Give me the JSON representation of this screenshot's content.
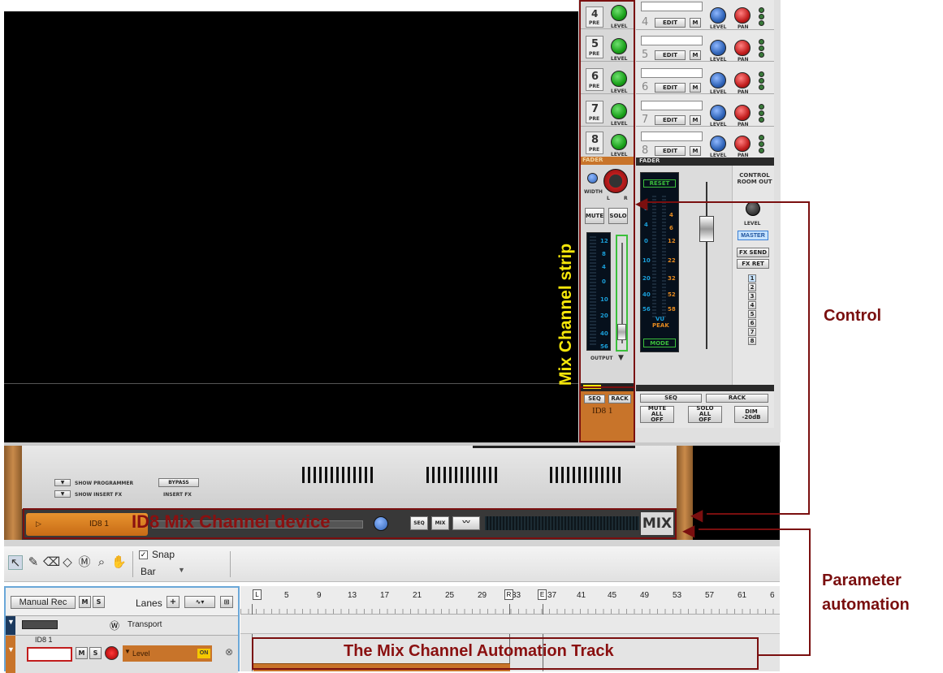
{
  "mixer": {
    "rows": [
      {
        "num": "4",
        "pre": "PRE",
        "level": "LEVEL"
      },
      {
        "num": "5",
        "pre": "PRE",
        "level": "LEVEL"
      },
      {
        "num": "6",
        "pre": "PRE",
        "level": "LEVEL"
      },
      {
        "num": "7",
        "pre": "PRE",
        "level": "LEVEL"
      },
      {
        "num": "8",
        "pre": "PRE",
        "level": "LEVEL"
      }
    ],
    "master_rows": [
      {
        "num": "4",
        "edit": "EDIT",
        "m": "M",
        "level": "LEVEL",
        "pan": "PAN"
      },
      {
        "num": "5",
        "edit": "EDIT",
        "m": "M",
        "level": "LEVEL",
        "pan": "PAN"
      },
      {
        "num": "6",
        "edit": "EDIT",
        "m": "M",
        "level": "LEVEL",
        "pan": "PAN"
      },
      {
        "num": "7",
        "edit": "EDIT",
        "m": "M",
        "level": "LEVEL",
        "pan": "PAN"
      },
      {
        "num": "8",
        "edit": "EDIT",
        "m": "M",
        "level": "LEVEL",
        "pan": "PAN"
      }
    ],
    "fader_label": "FADER",
    "channel": {
      "width": "WIDTH",
      "l": "L",
      "r": "R",
      "mute": "MUTE",
      "solo": "SOLO",
      "output": "OUTPUT",
      "meter_ticks": [
        "12",
        "8",
        "4",
        "0",
        "10",
        "20",
        "40",
        "56"
      ],
      "seq": "SEQ",
      "rack": "RACK",
      "name": "ID8 1"
    },
    "master": {
      "reset": "RESET",
      "meter_left": [
        "8",
        "4",
        "0",
        "10",
        "20",
        "40",
        "56"
      ],
      "meter_right": [
        "4",
        "6",
        "12",
        "22",
        "32",
        "52",
        "58"
      ],
      "vu": "VU",
      "peak": "PEAK",
      "mode": "MODE",
      "control_room": "CONTROL ROOM OUT",
      "level": "LEVEL",
      "master": "MASTER",
      "fx_send": "FX SEND",
      "fx_ret": "FX RET",
      "fx_nums": [
        "1",
        "2",
        "3",
        "4",
        "5",
        "6",
        "7",
        "8"
      ],
      "seq": "SEQ",
      "rack": "RACK",
      "mute_all": "MUTE ALL OFF",
      "solo_all": "SOLO ALL OFF",
      "dim": "DIM -20dB"
    }
  },
  "device": {
    "show_programmer": "SHOW PROGRAMMER",
    "show_insert": "SHOW INSERT FX",
    "bypass": "BYPASS",
    "insert_fx": "INSERT FX",
    "name": "ID8 1",
    "seq": "SEQ",
    "mix": "MIX",
    "label": "MIX"
  },
  "toolbar": {
    "snap": "Snap",
    "bar": "Bar"
  },
  "sequencer": {
    "manual_rec": "Manual Rec",
    "m": "M",
    "s": "S",
    "lanes": "Lanes",
    "ruler": [
      "5",
      "9",
      "13",
      "17",
      "21",
      "25",
      "29",
      "33",
      "37",
      "41",
      "45",
      "49",
      "53",
      "57",
      "61",
      "6"
    ],
    "transport": "Transport",
    "track_name": "ID8 1",
    "lane_param": "Level",
    "on": "ON",
    "l_marker": "L",
    "r_marker": "R",
    "e_marker": "E"
  },
  "annotations": {
    "strip": "Mix Channel strip",
    "device": "ID8 Mix Channel device",
    "control": "Control",
    "param": "Parameter automation",
    "track": "The Mix Channel Automation Track"
  },
  "colors": {
    "annot_red": "#7a0f0f",
    "strip_yellow": "#f5e60a",
    "knob_green": "#1aa11a",
    "knob_blue": "#2f63b7",
    "knob_red": "#c21d1d"
  }
}
